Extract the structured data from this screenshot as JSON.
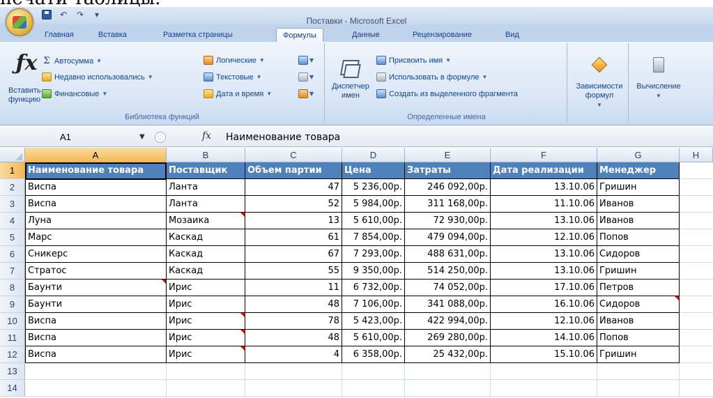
{
  "caption": "печати таблицы.",
  "window": {
    "title": "Поставки - Microsoft Excel"
  },
  "tabs": [
    {
      "label": "Главная",
      "active": false
    },
    {
      "label": "Вставка",
      "active": false
    },
    {
      "label": "Разметка страницы",
      "active": false
    },
    {
      "label": "Формулы",
      "active": true
    },
    {
      "label": "Данные",
      "active": false
    },
    {
      "label": "Рецензирование",
      "active": false
    },
    {
      "label": "Вид",
      "active": false
    }
  ],
  "ribbon": {
    "function_library": {
      "label": "Библиотека функций",
      "insert_function": "Вставить функцию",
      "autosum": "Автосумма",
      "recent": "Недавно использовались",
      "financial": "Финансовые",
      "logical": "Логические",
      "text": "Текстовые",
      "datetime": "Дата и время"
    },
    "defined_names": {
      "label": "Определенные имена",
      "name_manager": "Диспетчер имен",
      "assign_name": "Присвоить имя",
      "use_in_formula": "Использовать в формуле",
      "create_from_selection": "Создать из выделенного фрагмента"
    },
    "dependencies": "Зависимости формул",
    "calculation": "Вычисление"
  },
  "formula_bar": {
    "name_box": "A1",
    "fx": "fx",
    "value": "Наименование товара"
  },
  "columns": [
    "A",
    "B",
    "C",
    "D",
    "E",
    "F",
    "G",
    "H"
  ],
  "row_numbers": [
    "1",
    "2",
    "3",
    "4",
    "5",
    "6",
    "7",
    "8",
    "9",
    "10",
    "11",
    "12",
    "13",
    "14"
  ],
  "table": {
    "headers": [
      "Наименование товара",
      "Поставщик",
      "Объем партии",
      "Цена",
      "Затраты",
      "Дата реализации",
      "Менеджер"
    ],
    "rows": [
      [
        "Виспа",
        "Ланта",
        "47",
        "5 236,00р.",
        "246 092,00р.",
        "13.10.06",
        "Гришин"
      ],
      [
        "Виспа",
        "Ланта",
        "52",
        "5 984,00р.",
        "311 168,00р.",
        "11.10.06",
        "Иванов"
      ],
      [
        "Луна",
        "Мозаика",
        "13",
        "5 610,00р.",
        "72 930,00р.",
        "13.10.06",
        "Иванов"
      ],
      [
        "Марс",
        "Каскад",
        "61",
        "7 854,00р.",
        "479 094,00р.",
        "12.10.06",
        "Попов"
      ],
      [
        "Сникерс",
        "Каскад",
        "67",
        "7 293,00р.",
        "488 631,00р.",
        "13.10.06",
        "Сидоров"
      ],
      [
        "Стратос",
        "Каскад",
        "55",
        "9 350,00р.",
        "514 250,00р.",
        "13.10.06",
        "Гришин"
      ],
      [
        "Баунти",
        "Ирис",
        "11",
        "6 732,00р.",
        "74 052,00р.",
        "17.10.06",
        "Петров"
      ],
      [
        "Баунти",
        "Ирис",
        "48",
        "7 106,00р.",
        "341 088,00р.",
        "16.10.06",
        "Сидоров"
      ],
      [
        "Виспа",
        "Ирис",
        "78",
        "5 423,00р.",
        "422 994,00р.",
        "12.10.06",
        "Иванов"
      ],
      [
        "Виспа",
        "Ирис",
        "48",
        "5 610,00р.",
        "269 280,00р.",
        "14.10.06",
        "Попов"
      ],
      [
        "Виспа",
        "Ирис",
        "4",
        "6 358,00р.",
        "25 432,00р.",
        "15.10.06",
        "Гришин"
      ]
    ]
  },
  "colors": {
    "header_fill": "#4f81bd",
    "header_text": "#ffffff",
    "selected_header": "#f2b653",
    "comment_marker": "#e00000"
  }
}
